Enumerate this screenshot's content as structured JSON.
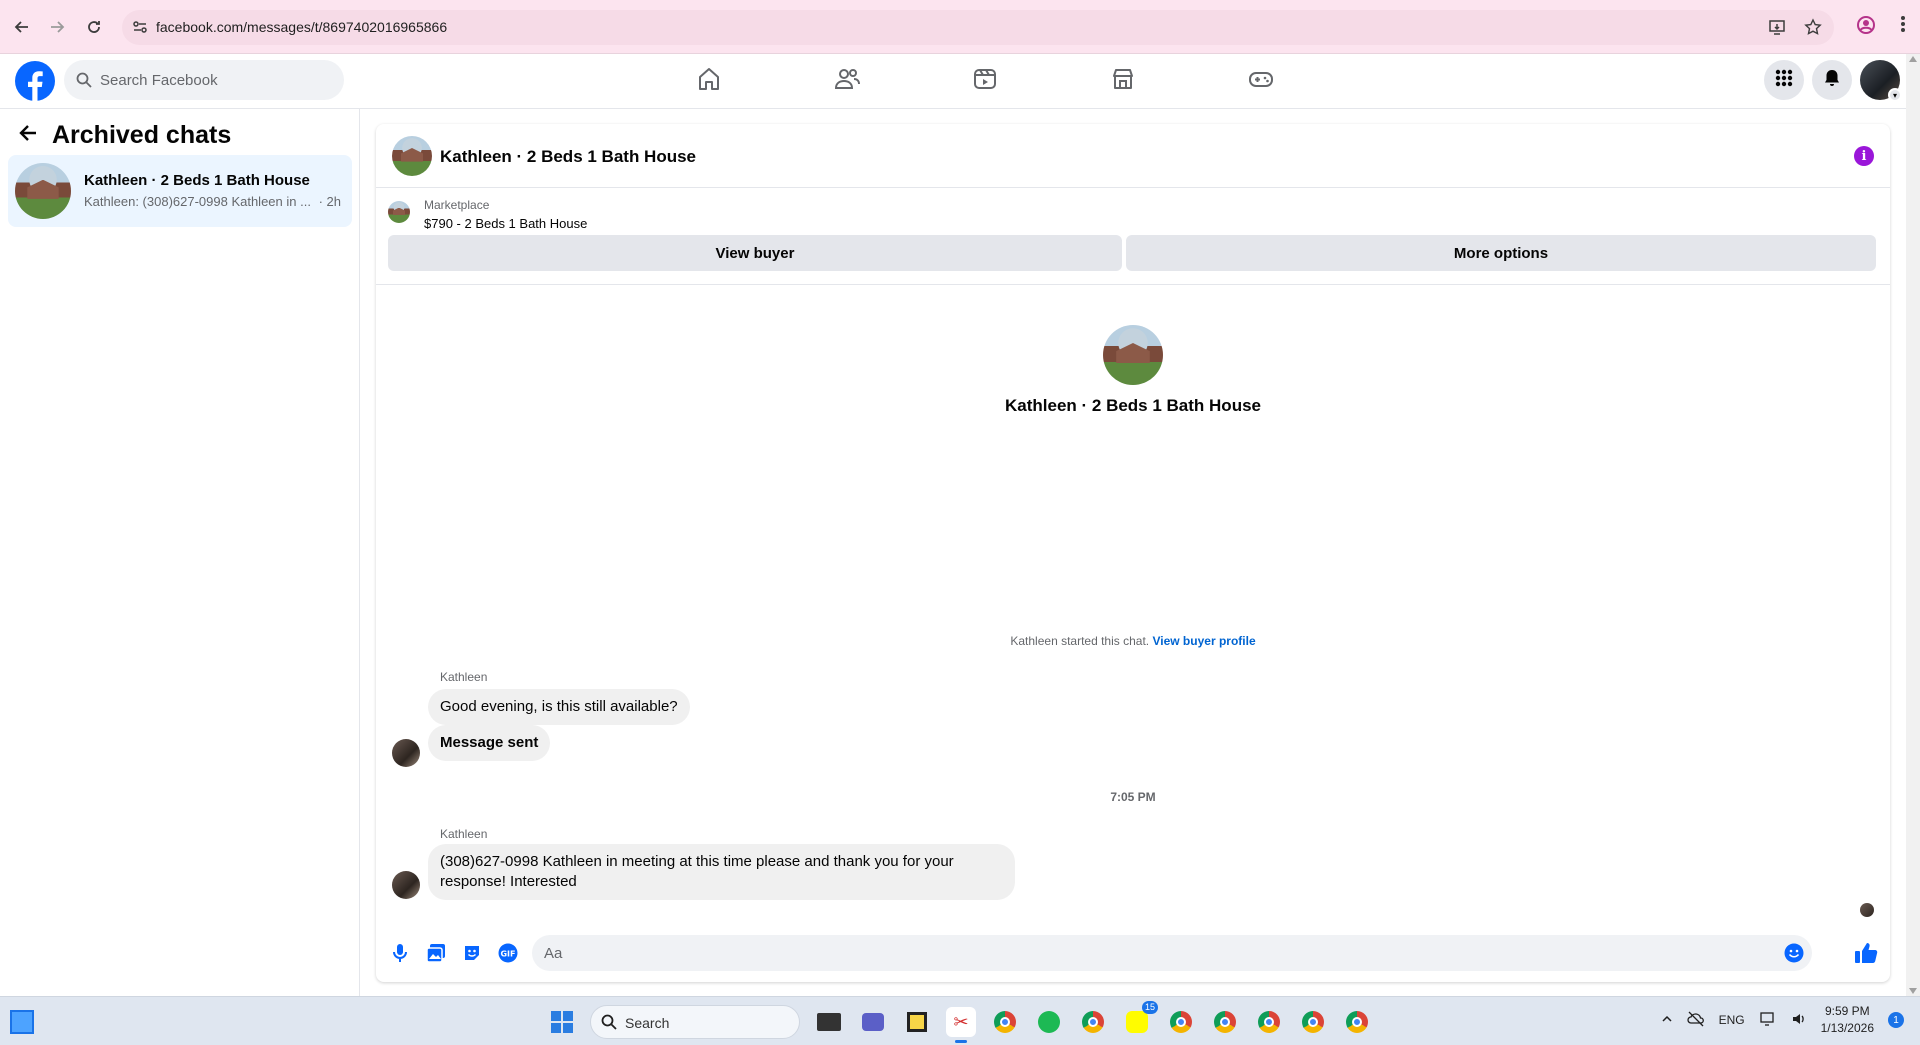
{
  "browser": {
    "url": "facebook.com/messages/t/8697402016965866"
  },
  "fbnav": {
    "search_placeholder": "Search Facebook"
  },
  "sidebar": {
    "title": "Archived chats",
    "chats": [
      {
        "name": "Kathleen · 2 Beds 1 Bath House",
        "preview": "Kathleen: (308)627-0998 Kathleen in ...",
        "time": "· 2h"
      }
    ]
  },
  "chat": {
    "title": "Kathleen · 2 Beds 1 Bath House",
    "marketplace": {
      "label": "Marketplace",
      "listing": "$790 - 2 Beds 1 Bath House",
      "view_buyer": "View buyer",
      "more_options": "More options"
    },
    "intro_name": "Kathleen · 2 Beds 1 Bath House",
    "system_text": "Kathleen started this chat.",
    "system_link": "View buyer profile",
    "messages": [
      {
        "sender": "Kathleen",
        "text": "Good evening, is this still available?"
      },
      {
        "text": "Message sent"
      },
      {
        "sender": "Kathleen",
        "text": "(308)627-0998 Kathleen  in meeting  at this time please and thank you for your response! Interested"
      }
    ],
    "timestamp": "7:05 PM",
    "composer_placeholder": "Aa"
  },
  "taskbar": {
    "search_label": "Search",
    "snapchat_badge": "15",
    "language": "ENG",
    "time": "9:59 PM",
    "date": "1/13/2026",
    "notification_count": "1"
  },
  "colors": {
    "facebook_blue": "#0866ff",
    "info_purple": "#9a16d9",
    "link_blue": "#0064d1",
    "selected_row": "#ebf5ff"
  }
}
